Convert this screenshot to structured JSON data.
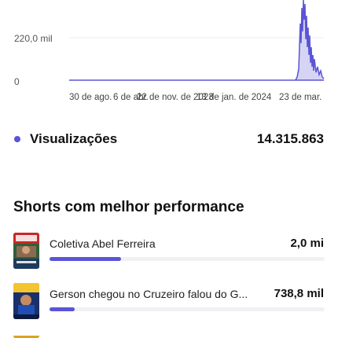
{
  "chart_data": {
    "type": "area",
    "y_ticks": [
      "220,0 mil",
      "0"
    ],
    "x_ticks": [
      "30 de ago.",
      "6 de abr.",
      "22 de nov. de 2023",
      "13 de jan. de 2024",
      "23 de mar."
    ],
    "series_color": "#5a54d6",
    "grid": true
  },
  "summary": {
    "label": "Visualizações",
    "value": "14.315.863",
    "color": "#5a54d6"
  },
  "section": {
    "title": "Shorts com melhor performance"
  },
  "shorts": [
    {
      "title": "Coletiva Abel Ferreira",
      "value": "2,0 mi",
      "bar_fraction": 0.26
    },
    {
      "title": "Gerson chegou no Cruzeiro falou do G...",
      "value": "738,8 mil",
      "bar_fraction": 0.09
    }
  ]
}
